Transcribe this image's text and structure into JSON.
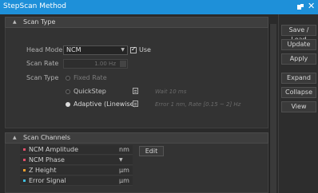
{
  "window": {
    "title": "StepScan Method"
  },
  "scan_type": {
    "header": "Scan Type",
    "head_mode": {
      "label": "Head Mode",
      "value": "NCM",
      "use_label": "Use",
      "use_checked": true
    },
    "scan_rate": {
      "label": "Scan Rate",
      "value": "1.00 Hz"
    },
    "scan_type": {
      "label": "Scan Type",
      "options": [
        {
          "label": "Fixed Rate",
          "selected": false,
          "enabled": false,
          "hint": ""
        },
        {
          "label": "QuickStep",
          "selected": false,
          "enabled": true,
          "hint": "Wait 10 ms"
        },
        {
          "label": "Adaptive (Linewise)",
          "selected": true,
          "enabled": true,
          "hint": "Error 1 nm, Rate [0.15 ~ 2] Hz"
        }
      ]
    }
  },
  "scan_channels": {
    "header": "Scan Channels",
    "edit_label": "Edit",
    "channels": [
      {
        "name": "NCM Amplitude",
        "unit": "nm",
        "color": "#e0506a"
      },
      {
        "name": "NCM Phase",
        "unit": "",
        "color": "#e0506a",
        "dropdown": true
      },
      {
        "name": "Z Height",
        "unit": "µm",
        "color": "#f0a030"
      },
      {
        "name": "Error Signal",
        "unit": "µm",
        "color": "#40c0e0"
      }
    ]
  },
  "side_buttons": [
    {
      "label": "Save / Load"
    },
    {
      "label": "Update"
    },
    {
      "label": "Apply"
    },
    {
      "label": "Expand"
    },
    {
      "label": "Collapse"
    },
    {
      "label": "View"
    }
  ]
}
